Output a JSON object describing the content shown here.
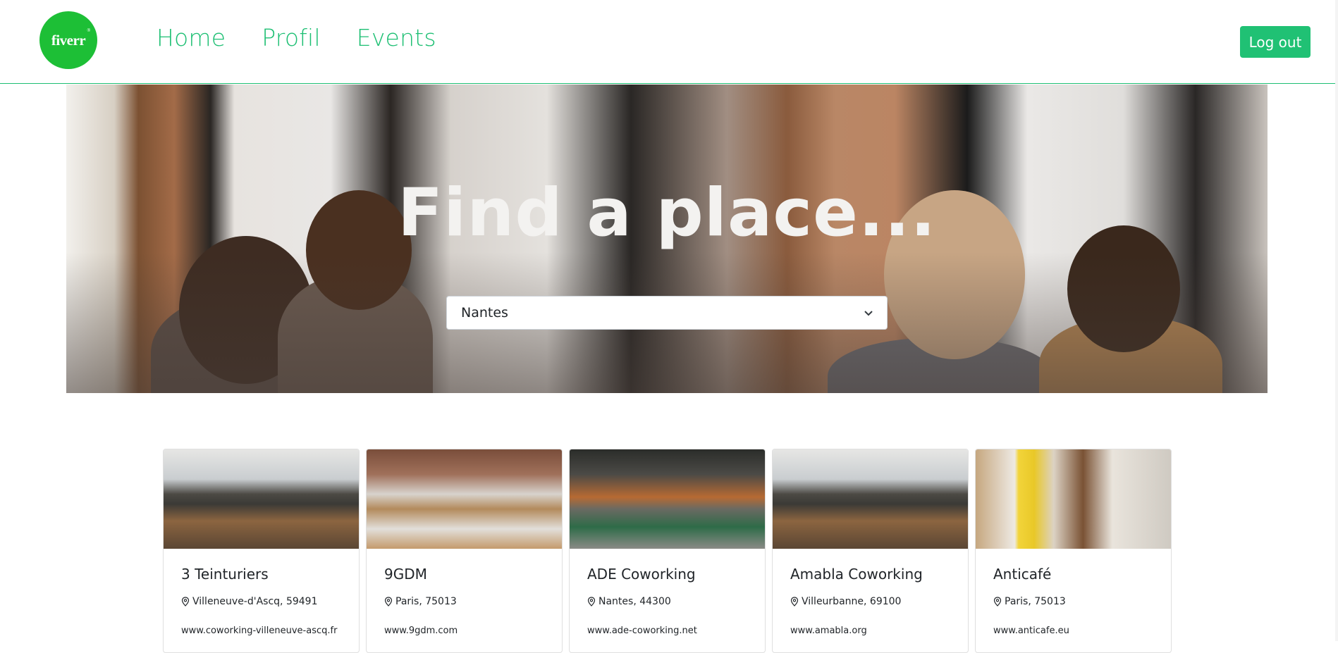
{
  "header": {
    "logo_text": "fiverr",
    "logo_mark": "®",
    "nav": [
      "Home",
      "Profil",
      "Events"
    ],
    "logout_label": "Log out",
    "accent_color": "#1dbf73"
  },
  "hero": {
    "title": "Find a place...",
    "city_select": {
      "selected": "Nantes"
    }
  },
  "places": [
    {
      "name": "3 Teinturiers",
      "location": "Villeneuve-d'Ascq, 59491",
      "website": "www.coworking-villeneuve-ascq.fr"
    },
    {
      "name": "9GDM",
      "location": "Paris, 75013",
      "website": "www.9gdm.com"
    },
    {
      "name": "ADE Coworking",
      "location": "Nantes, 44300",
      "website": "www.ade-coworking.net"
    },
    {
      "name": "Amabla Coworking",
      "location": "Villeurbanne, 69100",
      "website": "www.amabla.org"
    },
    {
      "name": "Anticafé",
      "location": "Paris, 75013",
      "website": "www.anticafe.eu"
    }
  ],
  "icons": {
    "location": "map-pin-icon",
    "select_chevron": "chevron-down-icon"
  }
}
